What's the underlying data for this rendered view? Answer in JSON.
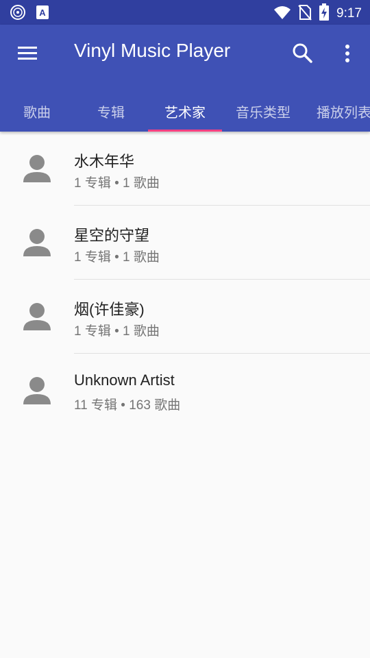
{
  "status_bar": {
    "time": "9:17",
    "left_icons": [
      "music-disc-icon",
      "text-a-icon"
    ],
    "right_icons": [
      "wifi-icon",
      "no-sim-icon",
      "battery-charging-icon"
    ]
  },
  "app_bar": {
    "title": "Vinyl Music Player",
    "color": "#3f51b5",
    "status_color": "#303f9f",
    "accent": "#ff4081"
  },
  "tabs": [
    {
      "label": "歌曲"
    },
    {
      "label": "专辑"
    },
    {
      "label": "艺术家",
      "active": true
    },
    {
      "label": "音乐类型"
    },
    {
      "label": "播放列表"
    }
  ],
  "artists": [
    {
      "name": "水木年华",
      "albums": "1",
      "songs": "1",
      "subtitle": "1 专辑 • 1 歌曲"
    },
    {
      "name": "星空的守望",
      "albums": "1",
      "songs": "1",
      "subtitle": "1 专辑 • 1 歌曲"
    },
    {
      "name": "烟(许佳豪)",
      "albums": "1",
      "songs": "1",
      "subtitle": "1 专辑 • 1 歌曲"
    },
    {
      "name": "Unknown Artist",
      "albums": "11",
      "songs": "163",
      "subtitle": "11 专辑 • 163 歌曲"
    }
  ]
}
